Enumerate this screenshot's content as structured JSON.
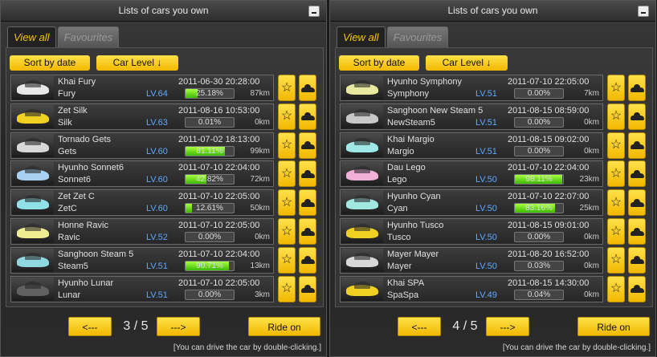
{
  "panels": [
    {
      "title": "Lists of cars you own",
      "tabs": [
        "View all",
        "Favourites"
      ],
      "sort_date": "Sort by date",
      "sort_level": "Car Level ↓",
      "prev": "<---",
      "next": "--->",
      "page": "3 / 5",
      "ride": "Ride on",
      "hint": "[You can drive the car by double-clicking.]",
      "cars": [
        {
          "name": "Khai Fury",
          "short": "Fury",
          "level": "LV.64",
          "date": "2011-06-30 20:28:00",
          "pct_text": "25.18%",
          "pct": 25.18,
          "km": "87km",
          "color": "#e8e8e8"
        },
        {
          "name": "Zet Silk",
          "short": "Silk",
          "level": "LV.63",
          "date": "2011-08-16 10:53:00",
          "pct_text": "0.01%",
          "pct": 0.01,
          "km": "0km",
          "color": "#f0d020"
        },
        {
          "name": "Tornado Gets",
          "short": "Gets",
          "level": "LV.60",
          "date": "2011-07-02 18:13:00",
          "pct_text": "81.11%",
          "pct": 81.11,
          "km": "99km",
          "color": "#d8d8d8"
        },
        {
          "name": "Hyunho Sonnet6",
          "short": "Sonnet6",
          "level": "LV.60",
          "date": "2011-07-10 22:04:00",
          "pct_text": "42.82%",
          "pct": 42.82,
          "km": "72km",
          "color": "#a8d0f0"
        },
        {
          "name": "Zet Zet C",
          "short": "ZetC",
          "level": "LV.60",
          "date": "2011-07-10 22:05:00",
          "pct_text": "12.61%",
          "pct": 12.61,
          "km": "50km",
          "color": "#90e0e8"
        },
        {
          "name": "Honne Ravic",
          "short": "Ravic",
          "level": "LV.52",
          "date": "2011-07-10 22:05:00",
          "pct_text": "0.00%",
          "pct": 0,
          "km": "0km",
          "color": "#f0ec90"
        },
        {
          "name": "Sanghoon Steam 5",
          "short": "Steam5",
          "level": "LV.51",
          "date": "2011-07-10 22:04:00",
          "pct_text": "90.71%",
          "pct": 90.71,
          "km": "13km",
          "color": "#90d8e0"
        },
        {
          "name": "Hyunho Lunar",
          "short": "Lunar",
          "level": "LV.51",
          "date": "2011-07-10 22:05:00",
          "pct_text": "0.00%",
          "pct": 0,
          "km": "3km",
          "color": "#606060"
        }
      ]
    },
    {
      "title": "Lists of cars you own",
      "tabs": [
        "View all",
        "Favourites"
      ],
      "sort_date": "Sort by date",
      "sort_level": "Car Level ↓",
      "prev": "<---",
      "next": "--->",
      "page": "4 / 5",
      "ride": "Ride on",
      "hint": "[You can drive the car by double-clicking.]",
      "cars": [
        {
          "name": "Hyunho Symphony",
          "short": "Symphony",
          "level": "LV.51",
          "date": "2011-07-10 22:05:00",
          "pct_text": "0.00%",
          "pct": 0,
          "km": "7km",
          "color": "#e8e8a0"
        },
        {
          "name": "Sanghoon New Steam 5",
          "short": "NewSteam5",
          "level": "LV.51",
          "date": "2011-08-15 08:59:00",
          "pct_text": "0.00%",
          "pct": 0,
          "km": "0km",
          "color": "#c8c8c8"
        },
        {
          "name": "Khai Margio",
          "short": "Margio",
          "level": "LV.51",
          "date": "2011-08-15 09:02:00",
          "pct_text": "0.00%",
          "pct": 0,
          "km": "0km",
          "color": "#a0e8e8"
        },
        {
          "name": "Dau Lego",
          "short": "Lego",
          "level": "LV.50",
          "date": "2011-07-10 22:04:00",
          "pct_text": "98.11%",
          "pct": 98.11,
          "km": "23km",
          "color": "#f0b0d8"
        },
        {
          "name": "Hyunho Cyan",
          "short": "Cyan",
          "level": "LV.50",
          "date": "2011-07-10 22:07:00",
          "pct_text": "83.16%",
          "pct": 83.16,
          "km": "25km",
          "color": "#a0e8e0"
        },
        {
          "name": "Hyunho Tusco",
          "short": "Tusco",
          "level": "LV.50",
          "date": "2011-08-15 09:01:00",
          "pct_text": "0.00%",
          "pct": 0,
          "km": "0km",
          "color": "#f0d020"
        },
        {
          "name": "Mayer Mayer",
          "short": "Mayer",
          "level": "LV.50",
          "date": "2011-08-20 16:52:00",
          "pct_text": "0.03%",
          "pct": 0.03,
          "km": "0km",
          "color": "#d8d8d8"
        },
        {
          "name": "Khai SPA",
          "short": "SpaSpa",
          "level": "LV.49",
          "date": "2011-08-15 14:30:00",
          "pct_text": "0.04%",
          "pct": 0.04,
          "km": "0km",
          "color": "#f0d020"
        }
      ]
    }
  ]
}
